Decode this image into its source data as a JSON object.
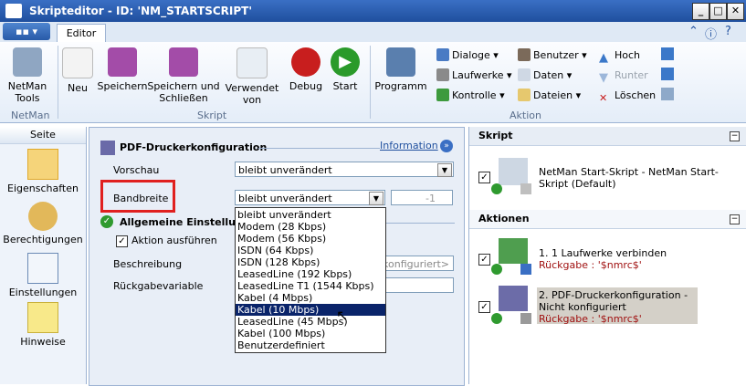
{
  "window": {
    "title": "Skripteditor - ID: 'NM_STARTSCRIPT'"
  },
  "tabs": {
    "active": "Editor"
  },
  "ribbon": {
    "netman_tools": "NetMan Tools",
    "group_netman": "NetMan",
    "neu": "Neu",
    "speichern": "Speichern",
    "speichern_schliessen": "Speichern und Schließen",
    "verwendet_von": "Verwendet von",
    "debug": "Debug",
    "start": "Start",
    "group_skript": "Skript",
    "programm": "Programm",
    "dialoge": "Dialoge",
    "laufwerke": "Laufwerke",
    "kontrolle": "Kontrolle",
    "benutzer": "Benutzer",
    "daten": "Daten",
    "dateien": "Dateien",
    "hoch": "Hoch",
    "runter": "Runter",
    "loeschen": "Löschen",
    "group_aktion": "Aktion"
  },
  "leftnav": {
    "header": "Seite",
    "items": [
      "Eigenschaften",
      "Berechtigungen",
      "Einstellungen",
      "Hinweise"
    ]
  },
  "main": {
    "title": "PDF-Druckerkonfiguration",
    "info_link": "Information",
    "vorschau_label": "Vorschau",
    "vorschau_value": "bleibt unverändert",
    "bandbreite_label": "Bandbreite",
    "bandbreite_value": "bleibt unverändert",
    "spinner_value": "-1",
    "general_section": "Allgemeine Einstellungen",
    "aktion_ausfuehren": "Aktion ausführen",
    "beschreibung_label": "Beschreibung",
    "beschreibung_placeholder": "t konfiguriert>",
    "rueckgabe_label": "Rückgabevariable",
    "options": [
      "bleibt unverändert",
      "Modem (28 Kbps)",
      "Modem (56 Kbps)",
      "ISDN (64 Kbps)",
      "ISDN (128 Kbps)",
      "LeasedLine (192 Kbps)",
      "LeasedLine T1 (1544 Kbps)",
      "Kabel (4 Mbps)",
      "Kabel (10 Mbps)",
      "LeasedLine (45 Mbps)",
      "Kabel (100 Mbps)",
      "Benutzerdefiniert"
    ],
    "selected_option": "Kabel (10 Mbps)"
  },
  "right": {
    "skript_header": "Skript",
    "skript_item": "NetMan Start-Skript - NetMan Start-Skript (Default)",
    "aktionen_header": "Aktionen",
    "action1_title": "1. 1 Laufwerke verbinden",
    "action1_return": "Rückgabe : '$nmrc$'",
    "action2_title": "2. PDF-Druckerkonfiguration - Nicht konfiguriert",
    "action2_return": "Rückgabe : '$nmrc$'"
  }
}
